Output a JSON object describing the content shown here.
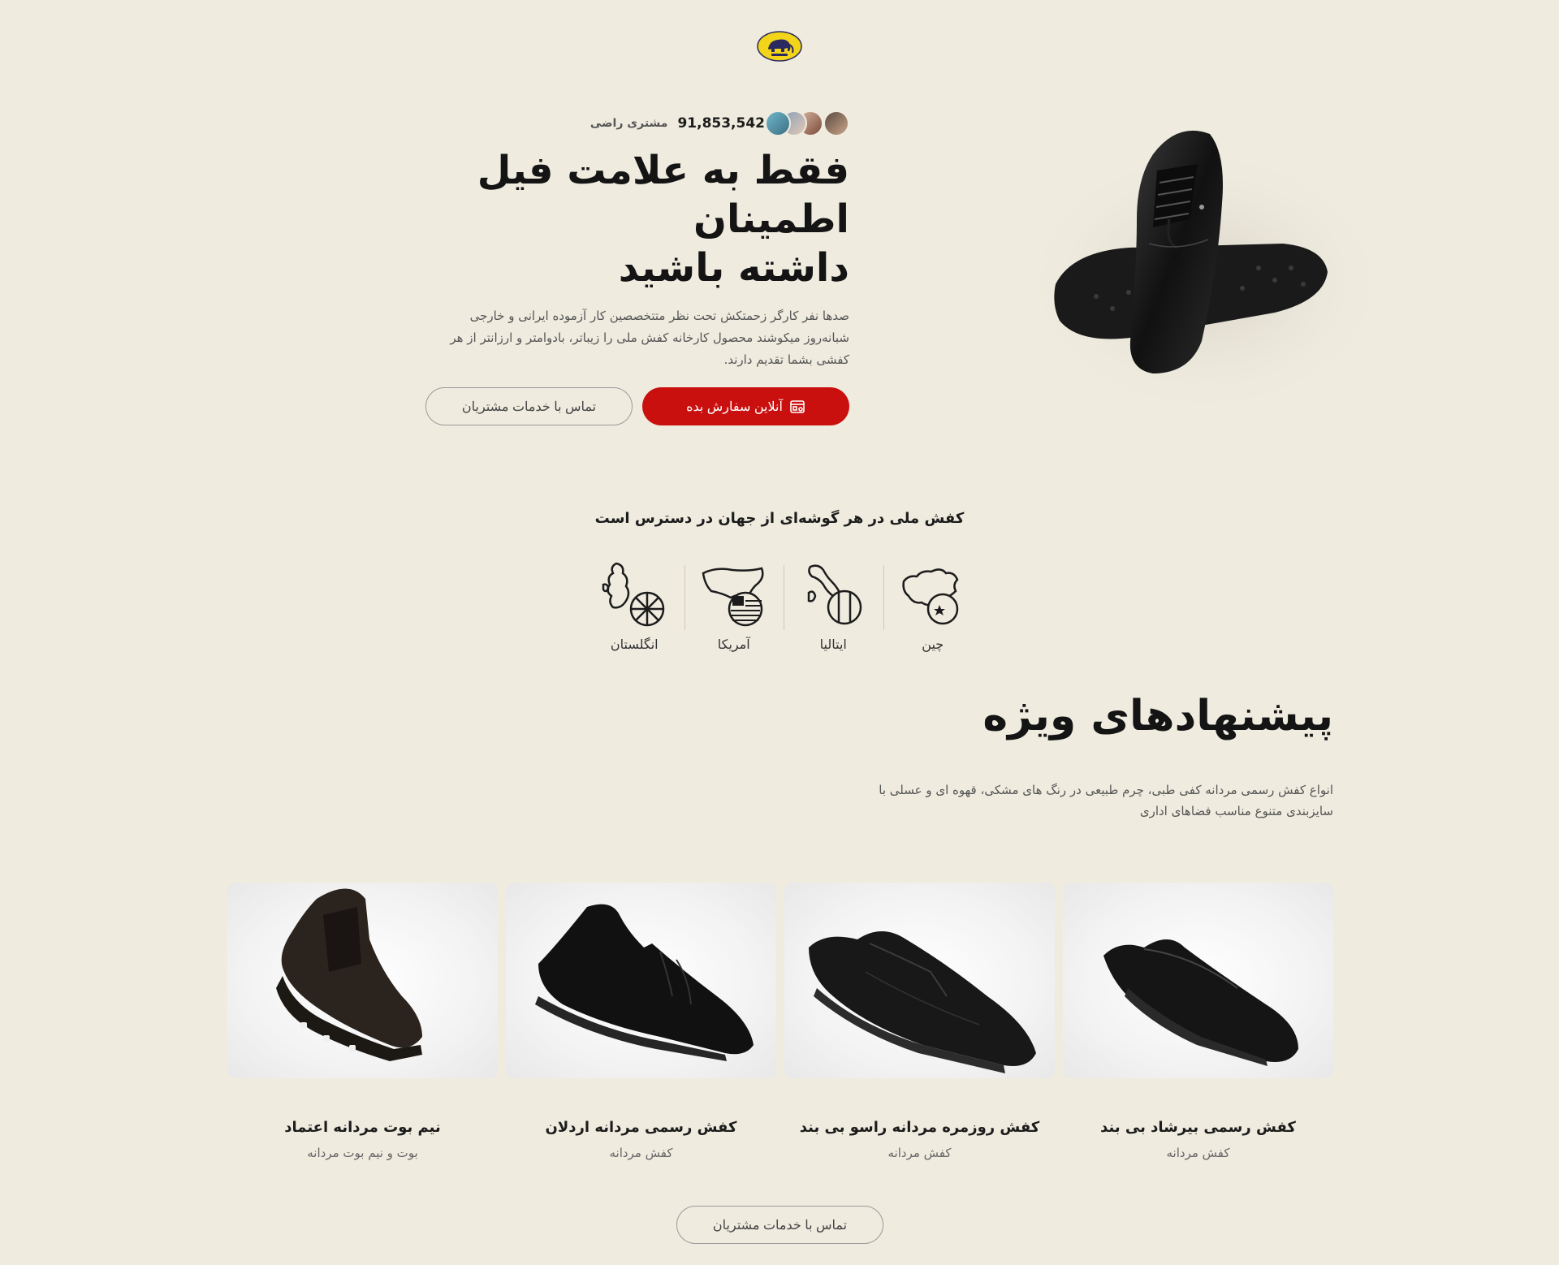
{
  "brand": {
    "logo_icon": "elephant-logo-icon",
    "logo_color": "#f2d41a"
  },
  "hero": {
    "customer_count": "91,853,542",
    "customer_label": "مشتری راضی",
    "title_line1": "فقط به علامت فیل اطمینان",
    "title_line2": "داشته باشید",
    "description": "صدها نفر کارگر زحمتکش تحت نظر متتخصصین کار آزموده ایرانی و خارجی شبانه‌روز میکوشند محصول کارخانه کفش ملی را زیباتر، بادوامتر و ارزانتر از هر کفشی بشما تقدیم دارند.",
    "order_button": "آنلاین سفارش بده",
    "contact_button": "تماس با خدمات مشتریان",
    "accent_color": "#c9100f"
  },
  "countries": {
    "title": "کفش ملی در هر گوشه‌ای از جهان در دسترس است",
    "items": [
      {
        "name": "چین",
        "icon": "china-map-icon"
      },
      {
        "name": "ایتالیا",
        "icon": "italy-map-icon"
      },
      {
        "name": "آمریکا",
        "icon": "usa-map-icon"
      },
      {
        "name": "انگلستان",
        "icon": "uk-map-icon"
      }
    ]
  },
  "specials": {
    "title": "پیشنهادهای ویژه",
    "description": "انواع کفش رسمی مردانه کفی طبی، چرم طبیعی در رنگ های مشکی، قهوه ای و عسلی با سایزبندی متنوع مناسب فضاهای اداری"
  },
  "products": [
    {
      "name": "کفش رسمی بیرشاد بی بند",
      "category": "کفش مردانه"
    },
    {
      "name": "کفش روزمره مردانه راسو بی بند",
      "category": "کفش مردانه"
    },
    {
      "name": "کفش رسمی مردانه اردلان",
      "category": "کفش مردانه"
    },
    {
      "name": "نیم بوت مردانه اعتماد",
      "category": "بوت و نیم بوت مردانه"
    }
  ],
  "footer": {
    "contact_button": "تماس با خدمات مشتریان"
  }
}
